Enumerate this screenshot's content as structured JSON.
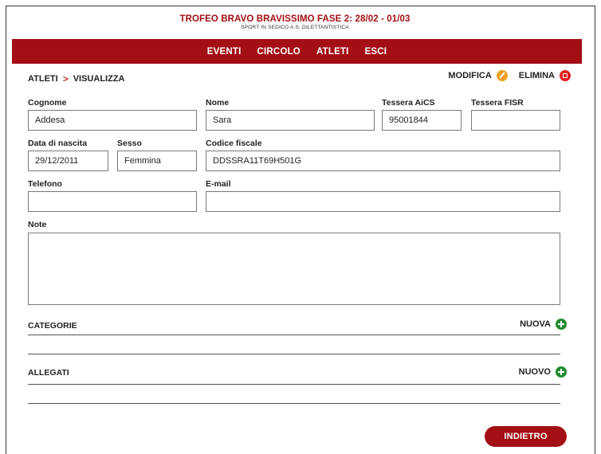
{
  "header": {
    "title": "TROFEO BRAVO BRAVISSIMO FASE 2: 28/02 - 01/03",
    "subtitle": "SPORT IN SEDICO A.S. DILETTANTISTICA"
  },
  "nav": {
    "items": [
      {
        "label": "EVENTI"
      },
      {
        "label": "CIRCOLO"
      },
      {
        "label": "ATLETI"
      },
      {
        "label": "ESCI"
      }
    ]
  },
  "breadcrumb": {
    "section": "ATLETI",
    "separator": ">",
    "page": "VISUALIZZA"
  },
  "actions": {
    "edit_label": "MODIFICA",
    "delete_label": "ELIMINA"
  },
  "form": {
    "cognome": {
      "label": "Cognome",
      "value": "Addesa"
    },
    "nome": {
      "label": "Nome",
      "value": "Sara"
    },
    "tessera_aics": {
      "label": "Tessera AiCS",
      "value": "95001844"
    },
    "tessera_fisr": {
      "label": "Tessera FISR",
      "value": ""
    },
    "data_nascita": {
      "label": "Data di nascita",
      "value": "29/12/2011"
    },
    "sesso": {
      "label": "Sesso",
      "value": "Femmina"
    },
    "codice_fiscale": {
      "label": "Codice fiscale",
      "value": "DDSSRA11T69H501G"
    },
    "telefono": {
      "label": "Telefono",
      "value": ""
    },
    "email": {
      "label": "E-mail",
      "value": ""
    },
    "note": {
      "label": "Note",
      "value": ""
    }
  },
  "categorie": {
    "title": "CATEGORIE",
    "add_label": "NUOVA"
  },
  "allegati": {
    "title": "ALLEGATI",
    "add_label": "NUOVO"
  },
  "footer": {
    "back_label": "INDIETRO"
  },
  "colors": {
    "brand": "#a30f14",
    "edit": "#f0a020",
    "delete": "#e02020",
    "add": "#1f8a2e"
  },
  "icons": [
    "chevron-right-icon",
    "pencil-icon",
    "delete-icon",
    "plus-icon"
  ]
}
